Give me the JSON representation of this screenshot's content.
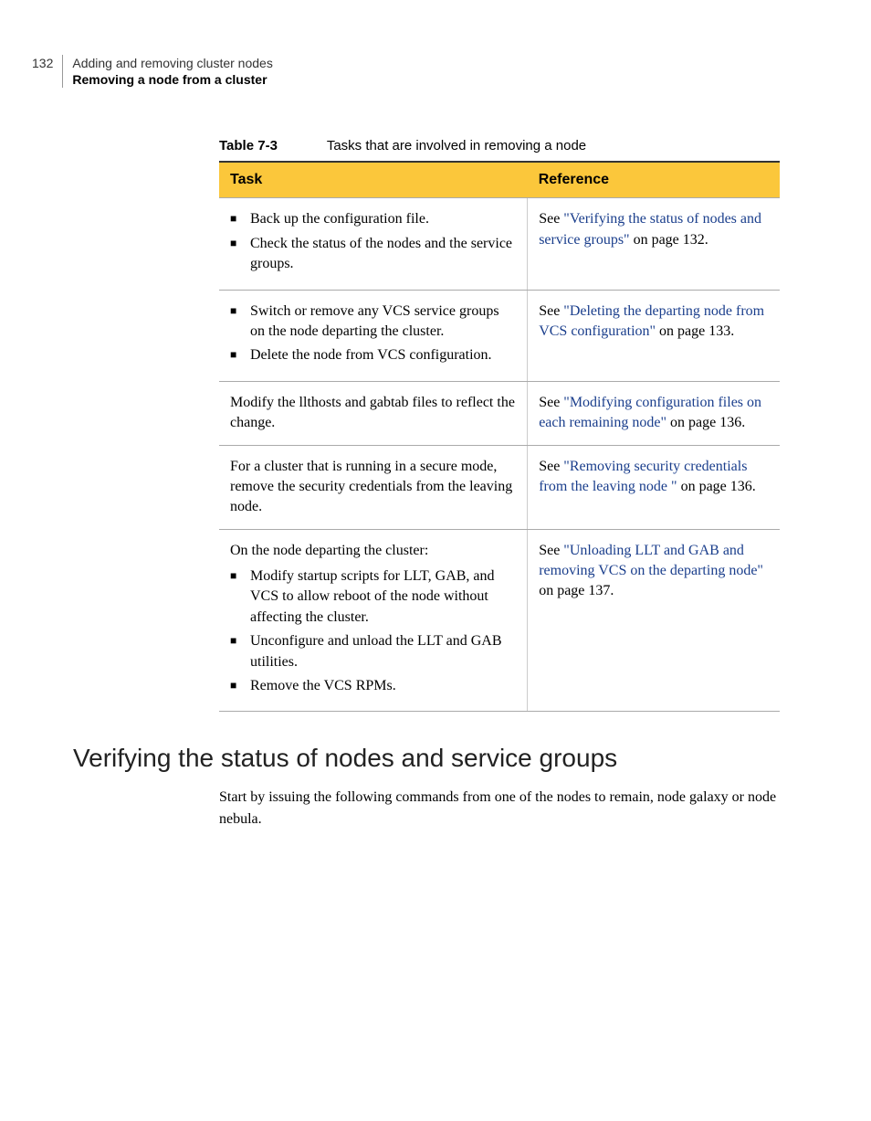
{
  "header": {
    "pageNumber": "132",
    "chapterTitle": "Adding and removing cluster nodes",
    "sectionTitle": "Removing a node from a cluster"
  },
  "table": {
    "label": "Table 7-3",
    "caption": "Tasks that are involved in removing a node",
    "headers": {
      "task": "Task",
      "reference": "Reference"
    },
    "rows": [
      {
        "tasks": [
          "Back up the configuration file.",
          "Check the status of the nodes and the service groups."
        ],
        "refPrefix": "See ",
        "refLink": "\"Verifying the status of nodes and service groups\"",
        "refSuffix": " on page 132."
      },
      {
        "tasks": [
          "Switch or remove any VCS service groups on the node departing the cluster.",
          "Delete the node from VCS configuration."
        ],
        "refPrefix": "See ",
        "refLink": "\"Deleting the departing node from VCS configuration\"",
        "refSuffix": " on page 133."
      },
      {
        "plain": "Modify the llthosts and gabtab files to reflect the change.",
        "refPrefix": "See ",
        "refLink": "\"Modifying configuration files on each remaining node\"",
        "refSuffix": " on page 136."
      },
      {
        "plain": "For a cluster that is running in a secure mode, remove the security credentials from the leaving node.",
        "refPrefix": "See ",
        "refLink": "\"Removing security credentials from the leaving node \"",
        "refSuffix": " on page 136."
      },
      {
        "lead": "On the node departing the cluster:",
        "tasks": [
          "Modify startup scripts for LLT, GAB, and VCS to allow reboot of the node without affecting the cluster.",
          "Unconfigure and unload the LLT and GAB utilities.",
          "Remove the VCS RPMs."
        ],
        "refPrefix": "See ",
        "refLink": "\"Unloading LLT and GAB and removing VCS on the departing node\"",
        "refSuffix": " on page 137."
      }
    ]
  },
  "section": {
    "heading": "Verifying the status of nodes and service groups",
    "body": "Start by issuing the following commands from one of the nodes to remain, node galaxy or node nebula."
  }
}
